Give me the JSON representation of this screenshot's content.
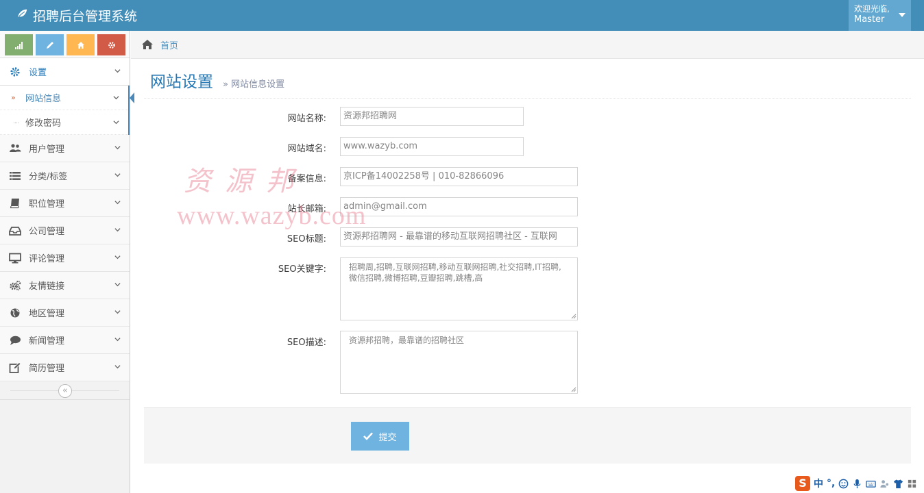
{
  "app": {
    "title": "招聘后台管理系统",
    "user_greeting": "欢迎光临,",
    "user_name": "Master"
  },
  "shortcuts": [
    {
      "name": "stats",
      "icon": "signal-icon",
      "color": "#82af6f"
    },
    {
      "name": "edit",
      "icon": "pencil-icon",
      "color": "#6fb3e0"
    },
    {
      "name": "home",
      "icon": "home-icon",
      "color": "#ffb752"
    },
    {
      "name": "settings",
      "icon": "gear-icon",
      "color": "#d15b47"
    }
  ],
  "sidebar": {
    "items": [
      {
        "label": "设置",
        "icon": "gear-icon",
        "active": true
      },
      {
        "label": "用户管理",
        "icon": "users-icon"
      },
      {
        "label": "分类/标签",
        "icon": "list-icon"
      },
      {
        "label": "职位管理",
        "icon": "book-icon"
      },
      {
        "label": "公司管理",
        "icon": "inbox-icon"
      },
      {
        "label": "评论管理",
        "icon": "desktop-icon"
      },
      {
        "label": "友情链接",
        "icon": "cogs-icon"
      },
      {
        "label": "地区管理",
        "icon": "globe-icon"
      },
      {
        "label": "新闻管理",
        "icon": "comment-icon"
      },
      {
        "label": "简历管理",
        "icon": "edit-icon"
      }
    ],
    "sub_items": [
      {
        "label": "网站信息",
        "active": true
      },
      {
        "label": "修改密码"
      }
    ],
    "collapse_icon": "«"
  },
  "breadcrumb": {
    "home_label": "首页"
  },
  "page": {
    "title": "网站设置",
    "subtitle": "» 网站信息设置"
  },
  "form": {
    "site_name": {
      "label": "网站名称:",
      "value": "资源邦招聘网"
    },
    "site_domain": {
      "label": "网站域名:",
      "value": "www.wazyb.com"
    },
    "icp": {
      "label": "备案信息:",
      "value": "京ICP备14002258号 | 010-82866096"
    },
    "email": {
      "label": "站长邮箱:",
      "value": "admin@gmail.com"
    },
    "seo_title": {
      "label": "SEO标题:",
      "value": "资源邦招聘网 - 最靠谱的移动互联网招聘社区 - 互联网"
    },
    "seo_keywords": {
      "label": "SEO关键字:",
      "value": "招聘周,招聘,互联网招聘,移动互联网招聘,社交招聘,IT招聘,微信招聘,微博招聘,豆瓣招聘,跳槽,高"
    },
    "seo_desc": {
      "label": "SEO描述:",
      "value": "资源邦招聘，最靠谱的招聘社区"
    },
    "submit_label": "提交"
  },
  "watermark": {
    "cn": "资源邦",
    "url": "www.wazyb.com"
  },
  "tray": {
    "ime_logo": "S",
    "ime_lang": "中",
    "ime_punct": "°,"
  }
}
